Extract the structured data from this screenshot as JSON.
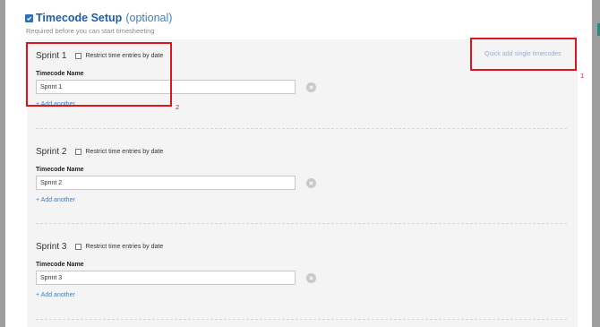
{
  "header": {
    "title": "Timecode Setup",
    "optional": "(optional)",
    "subtitle": "Required before you can start timesheeting",
    "checked": true
  },
  "quick_add_label": "Quick add single timecodes",
  "sections": [
    {
      "title": "Sprint 1",
      "restrict_label": "Restrict time entries by date",
      "field_label": "Timecode Name",
      "value": "Sprint 1",
      "add_label": "+ Add another"
    },
    {
      "title": "Sprint 2",
      "restrict_label": "Restrict time entries by date",
      "field_label": "Timecode Name",
      "value": "Sprint 2",
      "add_label": "+ Add another"
    },
    {
      "title": "Sprint 3",
      "restrict_label": "Restrict time entries by date",
      "field_label": "Timecode Name",
      "value": "Sprint 3",
      "add_label": "+ Add another"
    }
  ],
  "annotations": [
    "1",
    "2"
  ],
  "colors": {
    "accent": "#1e5ea6",
    "link": "#3e7fc4",
    "highlight": "#e0141e",
    "panel": "#f4f4f4"
  },
  "icons": {
    "clear": "close-circle-icon",
    "check": "check-icon"
  }
}
